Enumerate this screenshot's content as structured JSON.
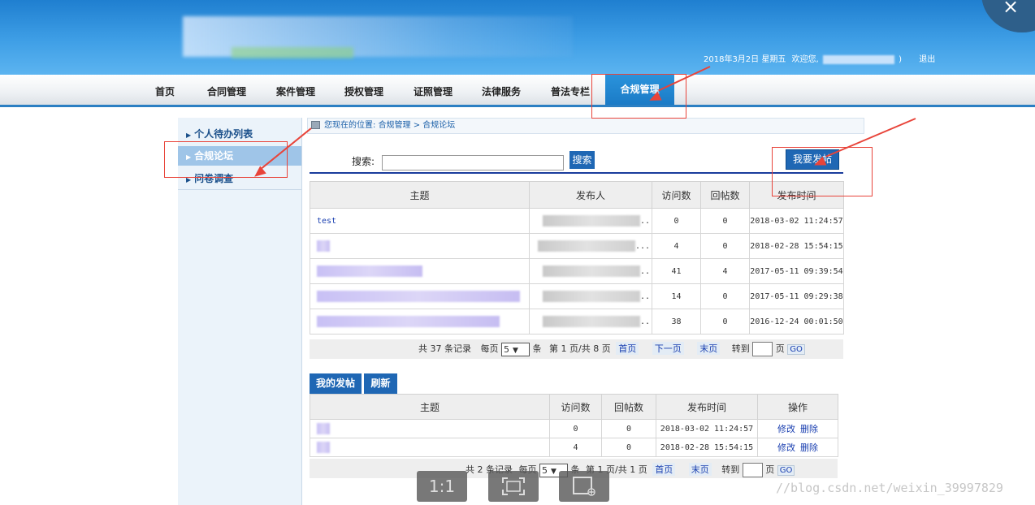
{
  "header": {
    "date": "2018年3月2日 星期五",
    "welcome": "欢迎您,",
    "welcome_close": ")",
    "logout": "退出",
    "close_glyph": "×"
  },
  "nav": {
    "items": [
      "首页",
      "合同管理",
      "案件管理",
      "授权管理",
      "证照管理",
      "法律服务",
      "普法专栏",
      "合规管理"
    ],
    "active": "合规管理"
  },
  "sidebar": {
    "items": [
      "个人待办列表",
      "合规论坛",
      "问卷调查"
    ],
    "active": "合规论坛"
  },
  "breadcrumb": {
    "prefix": "您现在的位置:",
    "path": "合规管理 > 合规论坛"
  },
  "search": {
    "label": "搜索:",
    "button": "搜索",
    "value": ""
  },
  "post_button": "我要发帖",
  "topics": {
    "columns": [
      "主题",
      "发布人",
      "访问数",
      "回帖数",
      "发布时间"
    ],
    "rows": [
      {
        "title": "test",
        "author": "..",
        "visits": "0",
        "replies": "0",
        "time": "2018-03-02 11:24:57"
      },
      {
        "title": "",
        "author": "...",
        "visits": "4",
        "replies": "0",
        "time": "2018-02-28 15:54:15"
      },
      {
        "title": "",
        "author": "..",
        "visits": "41",
        "replies": "4",
        "time": "2017-05-11 09:39:54"
      },
      {
        "title": "",
        "author": "..",
        "visits": "14",
        "replies": "0",
        "time": "2017-05-11 09:29:38"
      },
      {
        "title": "",
        "author": "..",
        "visits": "38",
        "replies": "0",
        "time": "2016-12-24 00:01:50"
      }
    ]
  },
  "pager1": {
    "total": "共 37 条记录",
    "per_page_label": "每页",
    "per_page": "5",
    "unit": "条",
    "page_info": "第 1 页/共 8 页",
    "first": "首页",
    "next": "下一页",
    "last": "末页",
    "goto": "转到",
    "page_unit": "页",
    "go": "GO"
  },
  "my_posts": {
    "tab_label": "我的发帖",
    "refresh_label": "刷新",
    "columns": [
      "主题",
      "访问数",
      "回帖数",
      "发布时间",
      "操作"
    ],
    "rows": [
      {
        "title": "",
        "visits": "0",
        "replies": "0",
        "time": "2018-03-02 11:24:57",
        "edit": "修改",
        "delete": "删除"
      },
      {
        "title": "",
        "visits": "4",
        "replies": "0",
        "time": "2018-02-28 15:54:15",
        "edit": "修改",
        "delete": "删除"
      }
    ]
  },
  "pager2": {
    "total": "共 2 条记录",
    "per_page_label": "每页",
    "per_page": "5",
    "unit": "条",
    "page_info": "第 1 页/共 1 页",
    "first": "首页",
    "last": "末页",
    "goto": "转到",
    "page_unit": "页",
    "go": "GO"
  },
  "viewer": {
    "actual_size": "1:1"
  },
  "watermark": "//blog.csdn.net/weixin_39997829",
  "colors": {
    "header_blue": "#3f9fe6",
    "button_blue": "#1f67b4",
    "annotation_red": "#e8443a"
  }
}
